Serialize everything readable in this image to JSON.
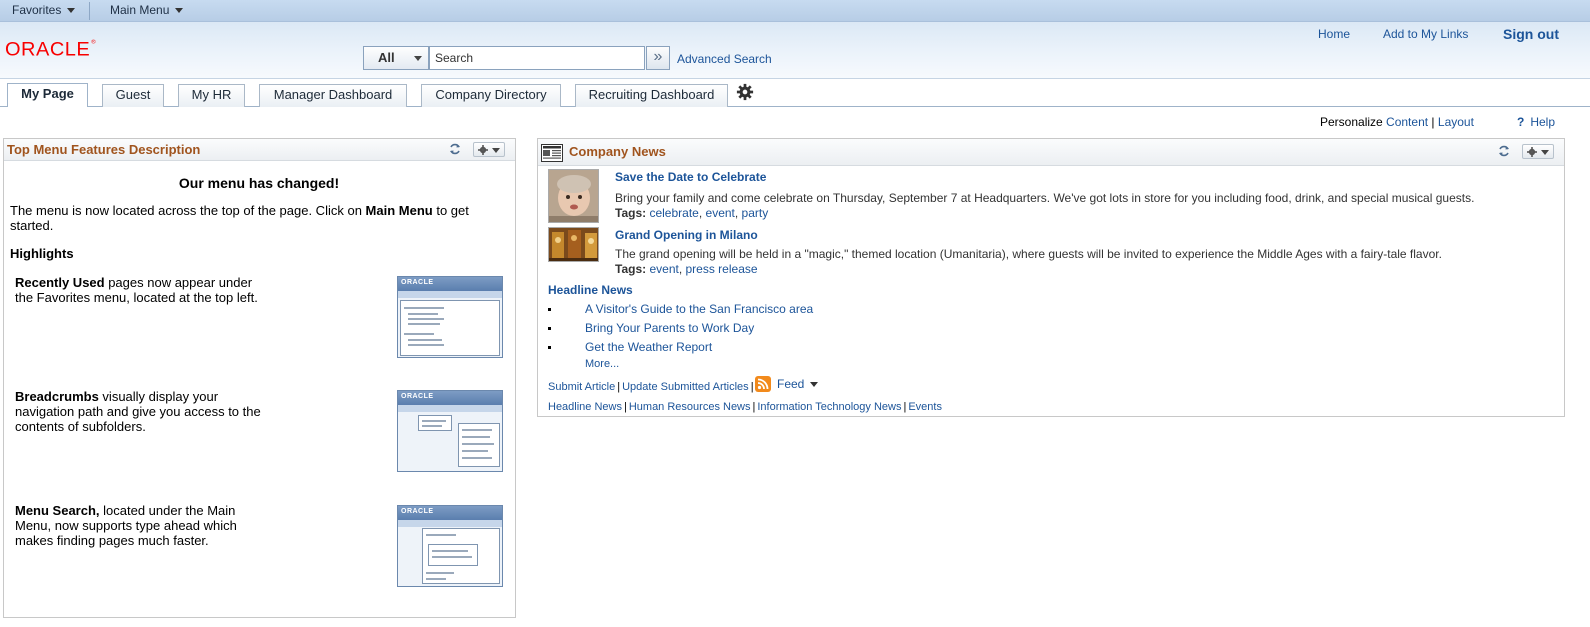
{
  "menubar": {
    "favorites": "Favorites",
    "main_menu": "Main Menu"
  },
  "brand": {
    "logo": "ORACLE"
  },
  "search": {
    "scope": "All",
    "placeholder": "Search",
    "advanced": "Advanced Search"
  },
  "header_links": {
    "home": "Home",
    "add_links": "Add to My Links",
    "sign_out": "Sign out"
  },
  "tabs": [
    {
      "label": "My Page",
      "active": true
    },
    {
      "label": "Guest"
    },
    {
      "label": "My HR"
    },
    {
      "label": "Manager Dashboard"
    },
    {
      "label": "Company Directory"
    },
    {
      "label": "Recruiting Dashboard"
    }
  ],
  "personalize": {
    "label": "Personalize",
    "content": "Content",
    "sep": "|",
    "layout": "Layout",
    "help": "Help",
    "help_q": "?"
  },
  "left_pagelet": {
    "title": "Top Menu Features Description",
    "heading": "Our menu has changed!",
    "intro_pre": "The menu is now located across the top of the page. Click on ",
    "intro_bold": "Main Menu",
    "intro_post": " to get started.",
    "highlights": "Highlights",
    "features": [
      {
        "bold": "Recently Used",
        "text": " pages now appear under the Favorites menu, located at the top left."
      },
      {
        "bold": "Breadcrumbs",
        "text": " visually display your navigation path and give you access to the contents of subfolders."
      },
      {
        "bold": "Menu Search,",
        "text": " located under the Main Menu, now supports type ahead which makes finding pages much faster."
      }
    ],
    "thumb_logo": "ORACLE"
  },
  "right_pagelet": {
    "title": "Company News",
    "articles": [
      {
        "title": "Save the Date to Celebrate",
        "text": "Bring your family and come celebrate on Thursday, September 7 at Headquarters. We've got lots in store for you including food, drink, and special musical guests.",
        "tags_label": "Tags:",
        "tags": [
          "celebrate",
          "event",
          "party"
        ]
      },
      {
        "title": "Grand Opening in Milano",
        "text": "The grand opening will be held in a \"magic,\" themed location (Umanitaria), where guests will be invited to experience the Middle Ages with a fairy-tale flavor.",
        "tags_label": "Tags:",
        "tags": [
          "event",
          "press release"
        ]
      }
    ],
    "headline_title": "Headline News",
    "headlines": [
      "A Visitor's Guide to the San Francisco area",
      "Bring Your Parents to Work Day",
      "Get the Weather Report"
    ],
    "more": "More...",
    "actions": {
      "submit": "Submit Article",
      "update": "Update Submitted Articles",
      "feed": "Feed",
      "sep": "|"
    },
    "categories": [
      "Headline News",
      "Human Resources News",
      "Information Technology News",
      "Events"
    ]
  }
}
